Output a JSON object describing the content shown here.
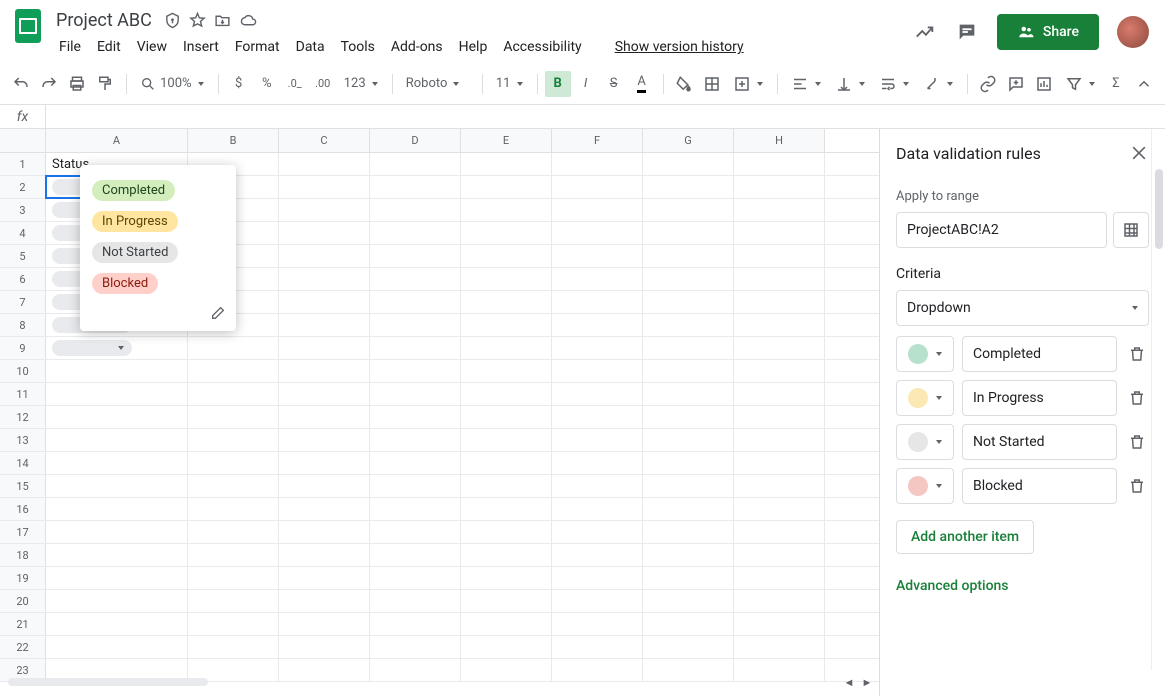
{
  "doc": {
    "title": "Project ABC"
  },
  "menus": [
    "File",
    "Edit",
    "View",
    "Insert",
    "Format",
    "Data",
    "Tools",
    "Add-ons",
    "Help",
    "Accessibility"
  ],
  "version_link": "Show version history",
  "share_label": "Share",
  "toolbar": {
    "zoom": "100%",
    "font": "Roboto",
    "font_size": "11",
    "number_fmt": "123"
  },
  "fx": {
    "label": "fx",
    "value": ""
  },
  "columns": [
    "A",
    "B",
    "C",
    "D",
    "E",
    "F",
    "G",
    "H"
  ],
  "row_count": 23,
  "cells": {
    "A1": "Status"
  },
  "dropdown_popup": [
    {
      "label": "Completed",
      "cls": "c-green"
    },
    {
      "label": "In Progress",
      "cls": "c-yellow"
    },
    {
      "label": "Not Started",
      "cls": "c-grey"
    },
    {
      "label": "Blocked",
      "cls": "c-red"
    }
  ],
  "panel": {
    "title": "Data validation rules",
    "apply_label": "Apply to range",
    "range": "ProjectABC!A2",
    "criteria_label": "Criteria",
    "criteria_value": "Dropdown",
    "options": [
      {
        "value": "Completed",
        "dot": "dot-green"
      },
      {
        "value": "In Progress",
        "dot": "dot-yellow"
      },
      {
        "value": "Not Started",
        "dot": "dot-grey"
      },
      {
        "value": "Blocked",
        "dot": "dot-red"
      }
    ],
    "add_item": "Add another item",
    "advanced": "Advanced options"
  }
}
